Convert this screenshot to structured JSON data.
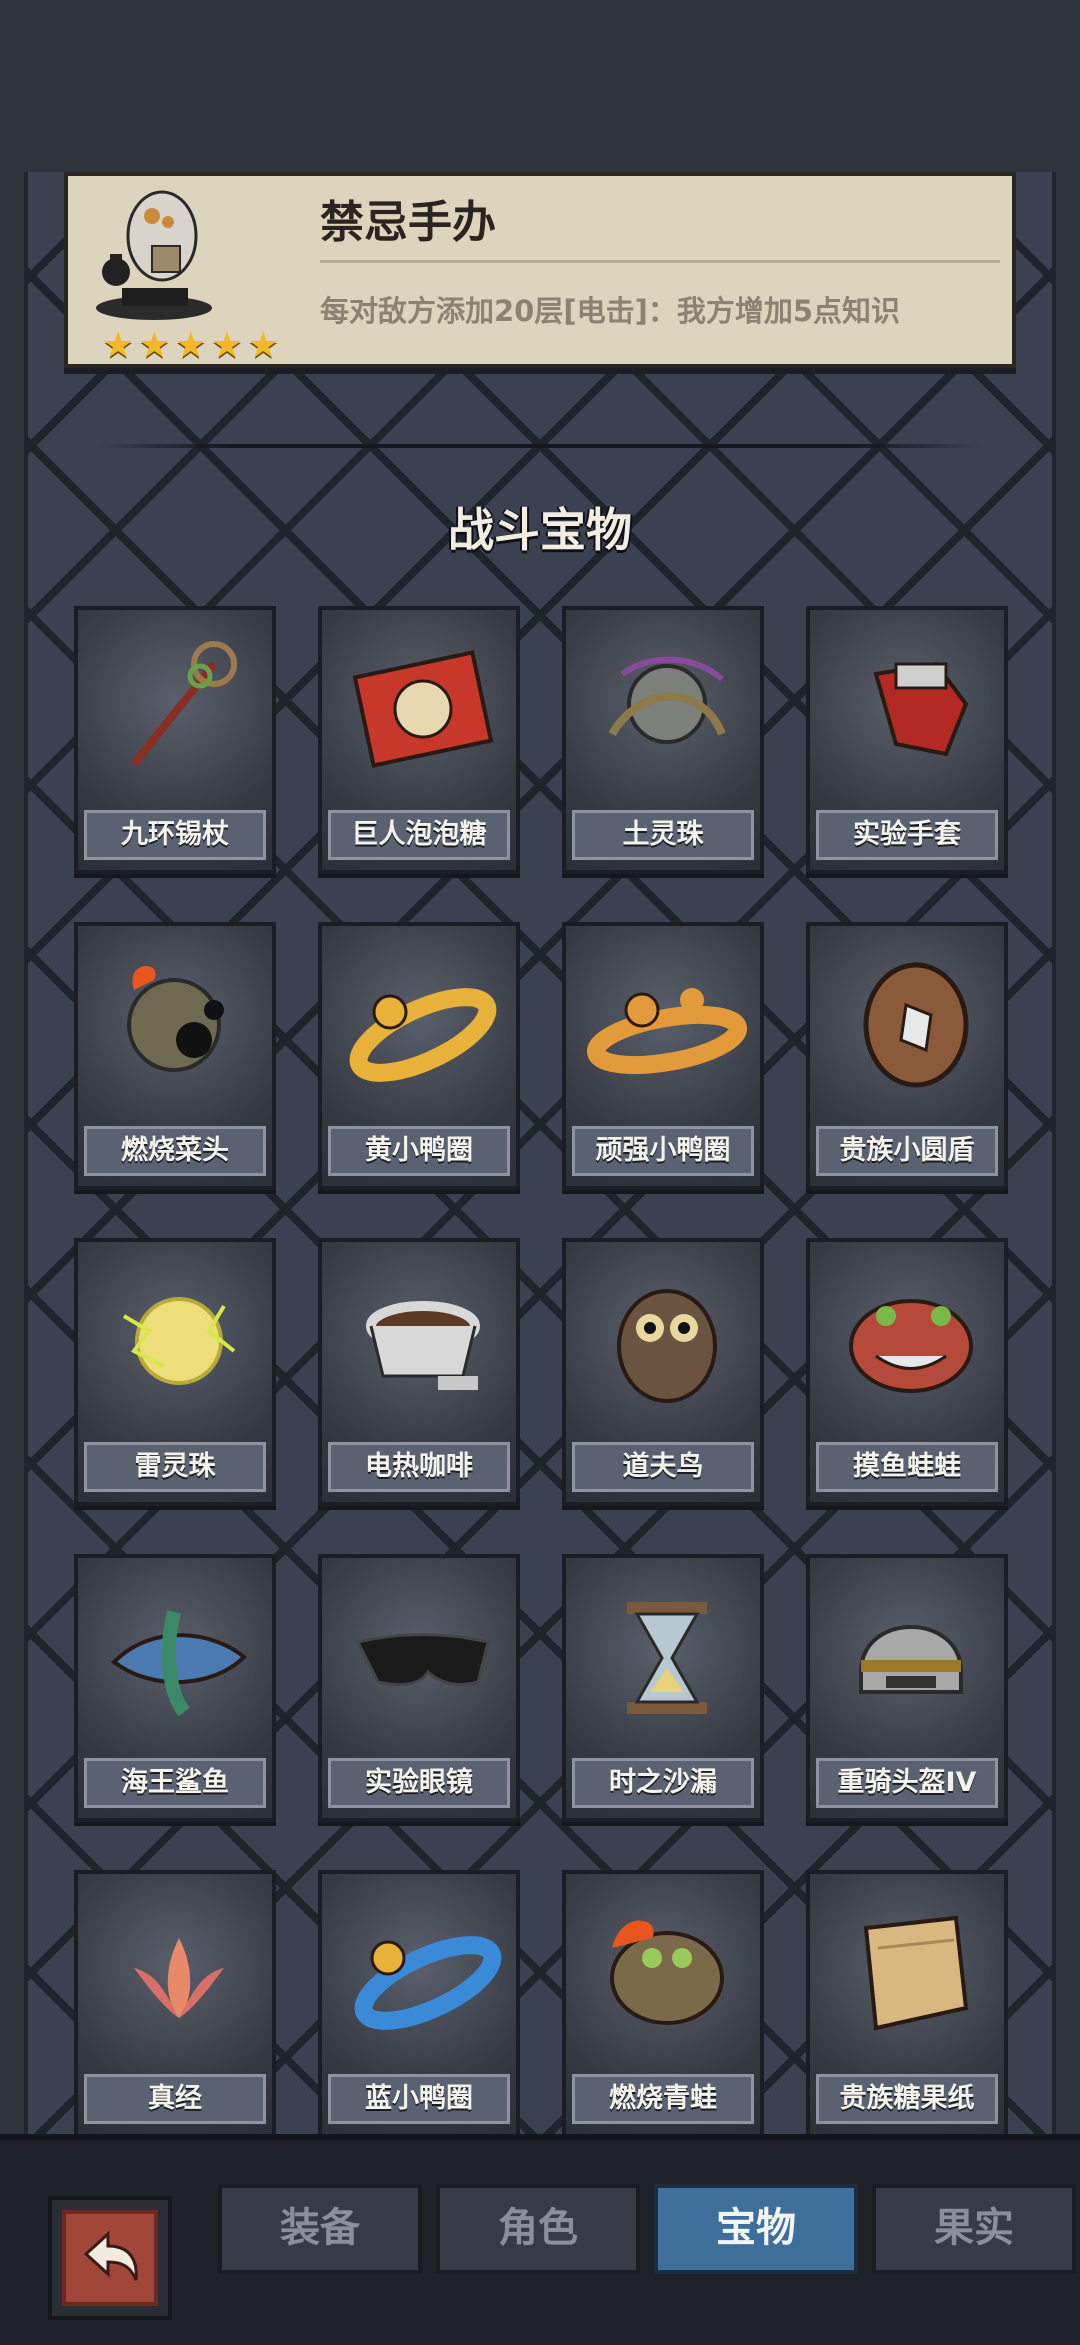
{
  "featured": {
    "title": "禁忌手办",
    "description": "每对敌方添加20层[电击]：我方增加5点知识",
    "stars": 5
  },
  "section_title": "战斗宝物",
  "items": [
    {
      "label": "九环锡杖",
      "icon": "staff-icon"
    },
    {
      "label": "巨人泡泡糖",
      "icon": "gum-box-icon"
    },
    {
      "label": "土灵珠",
      "icon": "earth-orb-icon"
    },
    {
      "label": "实验手套",
      "icon": "glove-icon"
    },
    {
      "label": "燃烧菜头",
      "icon": "burning-bomb-icon"
    },
    {
      "label": "黄小鸭圈",
      "icon": "yellow-duck-ring-icon"
    },
    {
      "label": "顽强小鸭圈",
      "icon": "strong-duck-ring-icon"
    },
    {
      "label": "贵族小圆盾",
      "icon": "round-shield-icon"
    },
    {
      "label": "雷灵珠",
      "icon": "thunder-orb-icon"
    },
    {
      "label": "电热咖啡",
      "icon": "coffee-cup-icon"
    },
    {
      "label": "道夫鸟",
      "icon": "owl-bird-icon"
    },
    {
      "label": "摸鱼蛙蛙",
      "icon": "frog-icon"
    },
    {
      "label": "海王鲨鱼",
      "icon": "shark-icon"
    },
    {
      "label": "实验眼镜",
      "icon": "goggles-icon"
    },
    {
      "label": "时之沙漏",
      "icon": "hourglass-icon"
    },
    {
      "label": "重骑头盔IV",
      "icon": "helmet-icon"
    },
    {
      "label": "真经",
      "icon": "lotus-icon"
    },
    {
      "label": "蓝小鸭圈",
      "icon": "blue-duck-ring-icon"
    },
    {
      "label": "燃烧青蛙",
      "icon": "burning-frog-icon"
    },
    {
      "label": "贵族糖果纸",
      "icon": "candy-wrapper-icon"
    }
  ],
  "tabs": [
    {
      "label": "装备",
      "active": false
    },
    {
      "label": "角色",
      "active": false
    },
    {
      "label": "宝物",
      "active": true
    },
    {
      "label": "果实",
      "active": false
    }
  ],
  "colors": {
    "accent_tab": "#3d6f9a",
    "star": "#f2b827",
    "card_bg": "#dcd4bd"
  }
}
